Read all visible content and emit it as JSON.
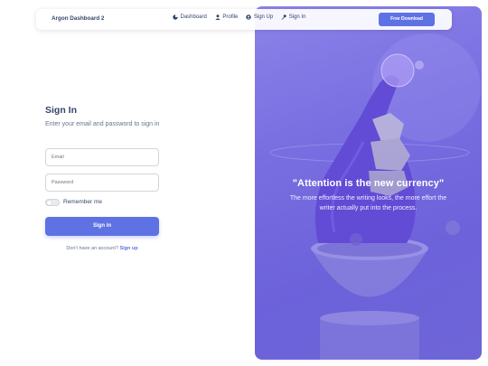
{
  "navbar": {
    "brand": "Argon Dashboard 2",
    "links": [
      {
        "label": "Dashboard",
        "icon": "dashboard-icon"
      },
      {
        "label": "Profile",
        "icon": "user-icon"
      },
      {
        "label": "Sign Up",
        "icon": "user-circle-icon"
      },
      {
        "label": "Sign In",
        "icon": "key-icon"
      }
    ],
    "download_label": "Free Download"
  },
  "form": {
    "title": "Sign In",
    "subtitle": "Enter your email and password to sign in",
    "email_placeholder": "Email",
    "password_placeholder": "Password",
    "remember_label": "Remember me",
    "remember_checked": false,
    "submit_label": "Sign in",
    "signup_prompt": "Don't have an account?",
    "signup_link": "Sign up"
  },
  "hero": {
    "quote": "\"Attention is the new currency\"",
    "subtext": "The more effortless the writing looks, the more effort the writer actually put into the process."
  },
  "colors": {
    "primary": "#5e72e4",
    "text_dark": "#344767",
    "text_muted": "#67748e",
    "hero_tint": "#7a6fe0"
  }
}
